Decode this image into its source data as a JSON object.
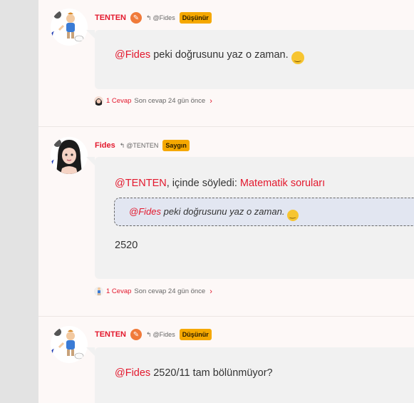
{
  "posts": [
    {
      "author": "TENTEN",
      "author_badge_icon": "pencil-icon",
      "reply_to": "@Fides",
      "rank": "Düşünür",
      "body_mention": "@Fides",
      "body_text": " peki doğrusunu yaz o zaman. ",
      "emoji": "slightly-smiling-face",
      "replies": "1 Cevap",
      "last_reply": "Son cevap 24 gün önce"
    },
    {
      "author": "Fides",
      "reply_to": "@TENTEN",
      "rank": "Saygın",
      "intro_mention": "@TENTEN",
      "intro_text": ", içinde söyledi: ",
      "intro_link": "Matematik soruları",
      "quote_mention": "@Fides",
      "quote_text": " peki doğrusunu yaz o zaman. ",
      "body_text": "2520",
      "replies": "1 Cevap",
      "last_reply": "Son cevap 24 gün önce"
    },
    {
      "author": "TENTEN",
      "author_badge_icon": "pencil-icon",
      "reply_to": "@Fides",
      "rank": "Düşünür",
      "body_mention": "@Fides",
      "body_text": " 2520/11 tam bölünmüyor?"
    }
  ],
  "colors": {
    "accent_red": "#e3182d",
    "rank_badge": "#f5a800",
    "bubble_bg": "#f1f1f1",
    "quote_bg": "#e2e6f1",
    "page_bg": "#fdf8f7"
  }
}
